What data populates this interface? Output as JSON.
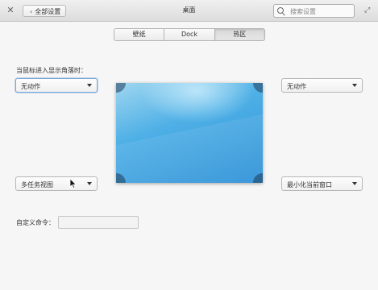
{
  "window": {
    "title": "桌面"
  },
  "header": {
    "back_label": "全部设置",
    "search_placeholder": "搜索设置"
  },
  "tabs": [
    {
      "label": "壁纸",
      "active": false
    },
    {
      "label": "Dock",
      "active": false
    },
    {
      "label": "热区",
      "active": true
    }
  ],
  "hot_corners": {
    "section_label": "当鼠标进入显示角落时：",
    "top_left": "无动作",
    "top_right": "无动作",
    "bottom_left": "多任务视图",
    "bottom_right": "最小化当前窗口"
  },
  "custom_command": {
    "label": "自定义命令：",
    "value": ""
  },
  "colors": {
    "accent": "#3c9fe0",
    "preview_light": "#9fd6f0",
    "preview_dark": "#2b8fd6"
  }
}
